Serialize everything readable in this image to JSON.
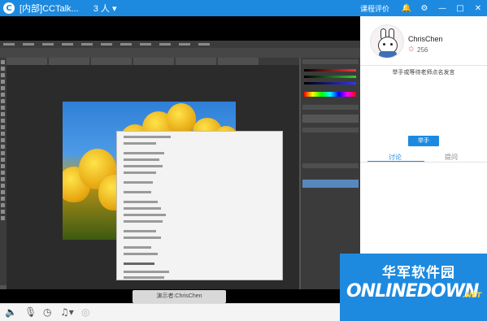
{
  "titlebar": {
    "logo_glyph": "C",
    "title": "[内部]CCTalk...",
    "people": "3 人 ▾",
    "eval_label": "课程评价",
    "icons": [
      "bell-icon",
      "settings-icon",
      "minimize-icon",
      "maximize-icon",
      "close-icon"
    ],
    "icon_glyphs": [
      "🔔",
      "⚙",
      "—",
      "□",
      "✕"
    ],
    "accent": "#1d8ae0"
  },
  "stage": {
    "presenter_label": "演示者:ChrisChen"
  },
  "sidebar": {
    "user_name": "ChrisChen",
    "star_glyph": "✩",
    "score": "256",
    "hand_raise_text": "举手或等待老师点名发言",
    "hand_raise_button": "举手",
    "tabs": [
      {
        "label": "讨论",
        "active": true
      },
      {
        "label": "提问",
        "active": false
      }
    ]
  },
  "bottombar": {
    "icons": [
      "speaker-icon",
      "microphone-icon",
      "clock-icon",
      "music-icon",
      "record-icon"
    ],
    "icon_glyphs": [
      "🔈",
      "🎙",
      "◷",
      "♫▾",
      "◎"
    ]
  },
  "watermark": {
    "cn_text": "华军软件园",
    "en_text": "ONLINEDOWN",
    "suffix": ".NET"
  }
}
